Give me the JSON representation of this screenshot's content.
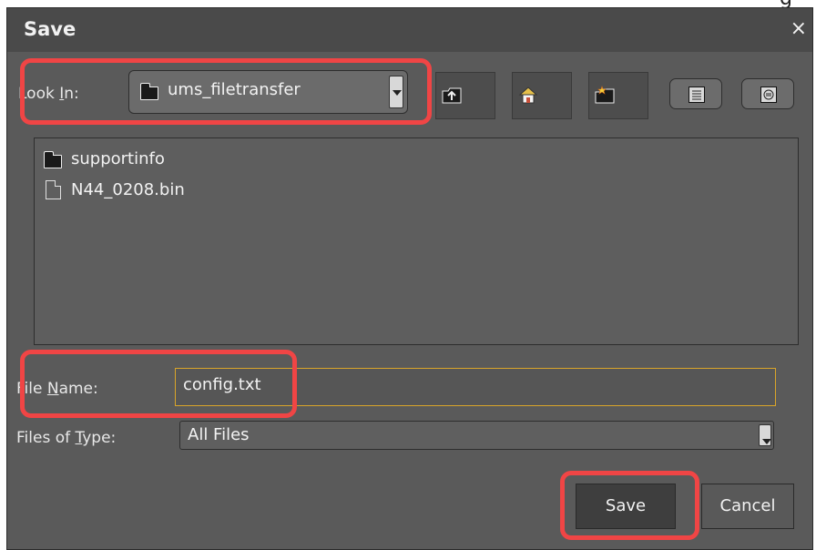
{
  "dialog": {
    "title": "Save",
    "close_glyph": "×",
    "cut_glyph": "g"
  },
  "look_in": {
    "label_before": "Look ",
    "label_mnemonic": "I",
    "label_after": "n:",
    "value": "ums_filetransfer",
    "icon": "folder-icon"
  },
  "toolbar": {
    "buttons": [
      {
        "name": "up-one-level-icon"
      },
      {
        "name": "home-icon"
      },
      {
        "name": "new-folder-icon"
      },
      {
        "name": "list-view-icon"
      },
      {
        "name": "details-view-icon"
      }
    ]
  },
  "files": [
    {
      "name": "supportinfo",
      "type": "folder",
      "icon": "folder-icon"
    },
    {
      "name": "N44_0208.bin",
      "type": "file",
      "icon": "file-icon"
    }
  ],
  "file_name": {
    "label_before": "File ",
    "label_mnemonic": "N",
    "label_after": "ame:",
    "value": "config.txt"
  },
  "files_of_type": {
    "label_before": "Files of ",
    "label_mnemonic": "T",
    "label_after": "ype:",
    "value": "All Files"
  },
  "buttons": {
    "save": "Save",
    "cancel": "Cancel"
  },
  "colors": {
    "highlight": "#f04545",
    "focus_border": "#d9a52a",
    "background": "#5a5a5a"
  }
}
